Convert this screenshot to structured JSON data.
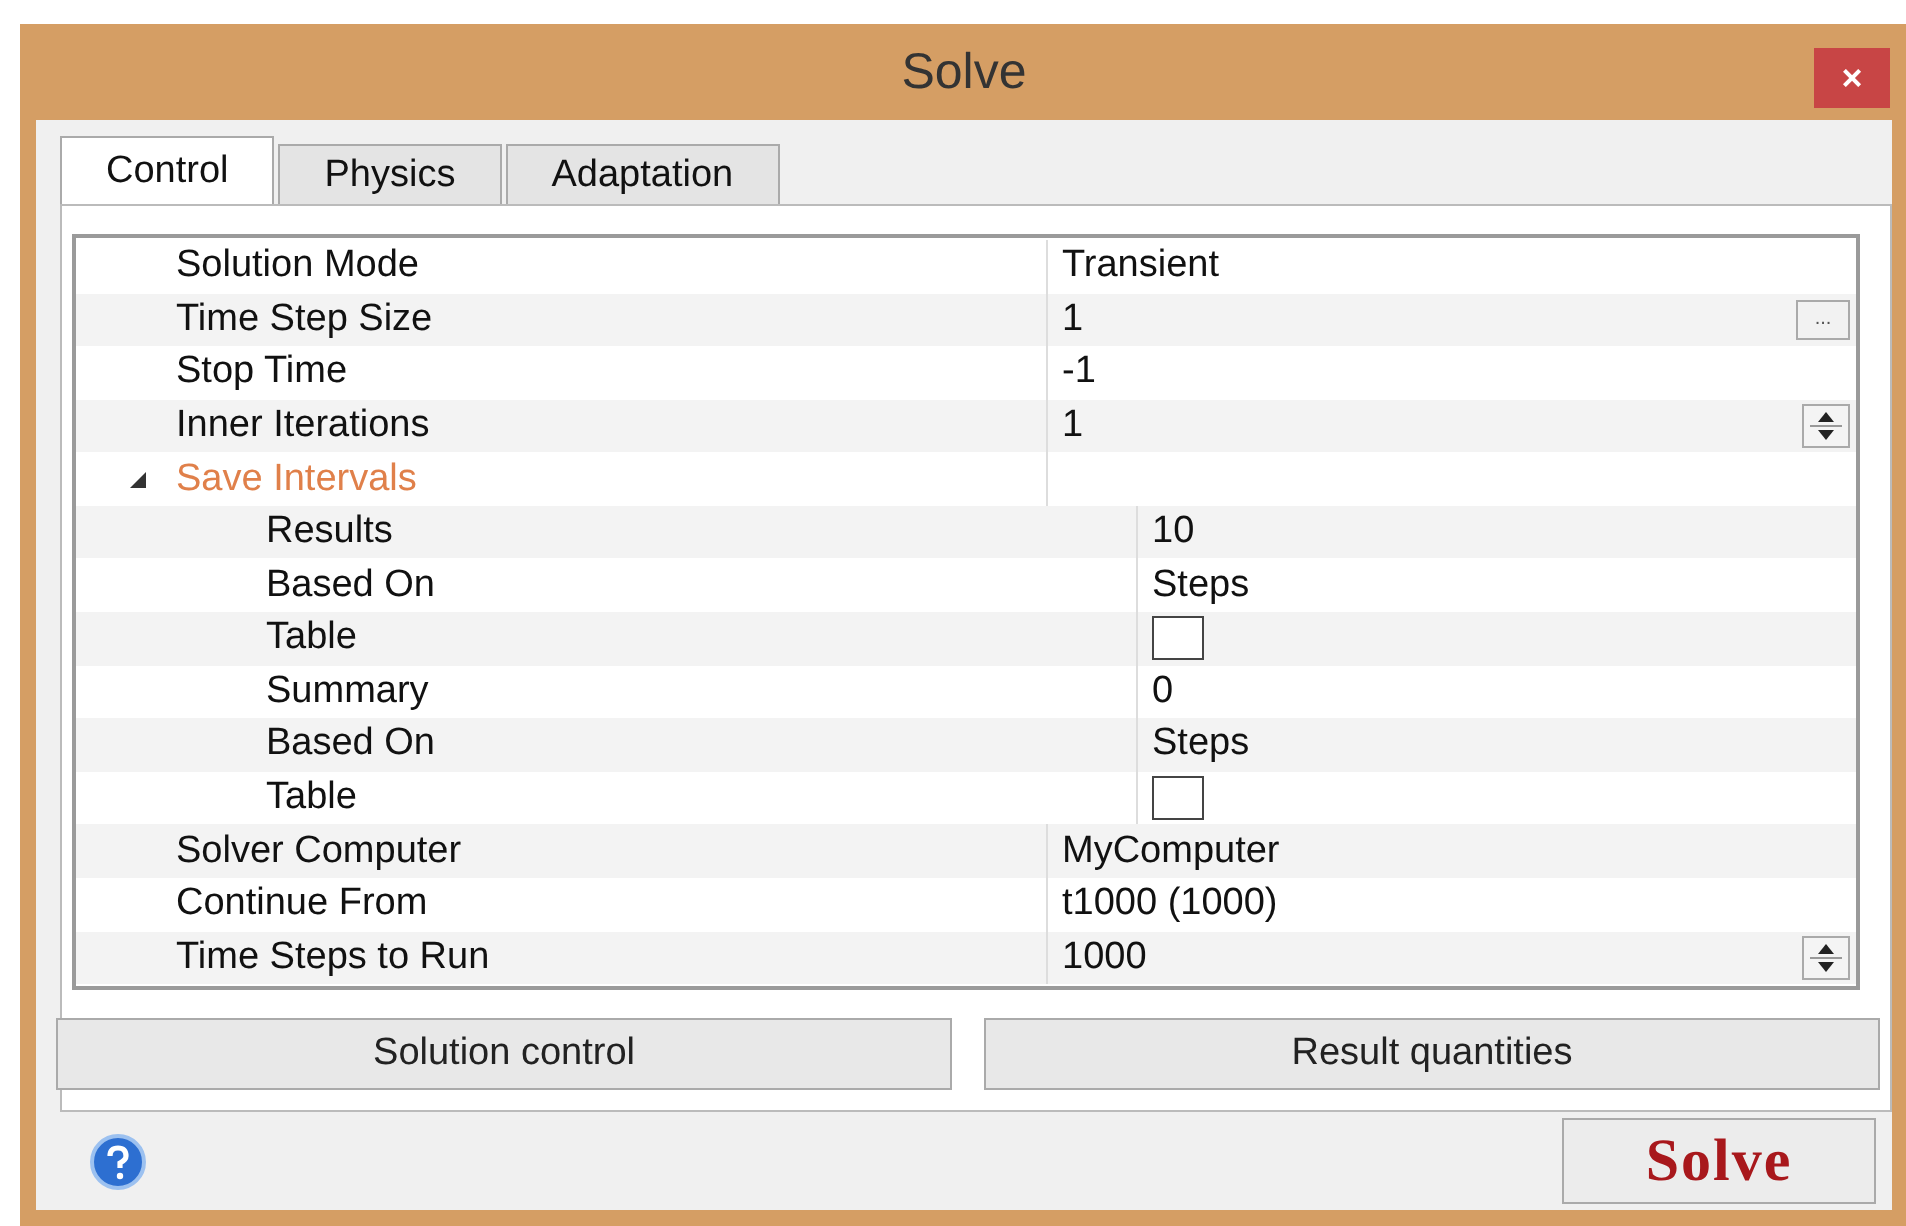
{
  "window": {
    "title": "Solve",
    "close": "×"
  },
  "tabs": [
    {
      "label": "Control",
      "selected": true
    },
    {
      "label": "Physics",
      "selected": false
    },
    {
      "label": "Adaptation",
      "selected": false
    }
  ],
  "properties": [
    {
      "label": "Solution Mode",
      "kind": "text",
      "value": "Transient"
    },
    {
      "label": "Time Step Size",
      "kind": "button",
      "value": "1",
      "button": "..."
    },
    {
      "label": "Stop Time",
      "kind": "text",
      "value": "-1"
    },
    {
      "label": "Inner Iterations",
      "kind": "spinner",
      "value": "1"
    },
    {
      "label": "Save Intervals",
      "kind": "group",
      "expanded": true,
      "children": [
        {
          "label": "Results",
          "kind": "text",
          "value": "10"
        },
        {
          "label": "Based On",
          "kind": "text",
          "value": "Steps"
        },
        {
          "label": "Table",
          "kind": "checkbox",
          "checked": false
        },
        {
          "label": "Summary",
          "kind": "text",
          "value": "0"
        },
        {
          "label": "Based On",
          "kind": "text",
          "value": "Steps"
        },
        {
          "label": "Table",
          "kind": "checkbox",
          "checked": false
        }
      ]
    },
    {
      "label": "Solver Computer",
      "kind": "text",
      "value": "MyComputer"
    },
    {
      "label": "Continue From",
      "kind": "text",
      "value": "t1000 (1000)"
    },
    {
      "label": "Time Steps to Run",
      "kind": "spinner",
      "value": "1000"
    }
  ],
  "buttons": [
    "Solution control",
    "Result quantities"
  ],
  "solve_button": "Solve"
}
